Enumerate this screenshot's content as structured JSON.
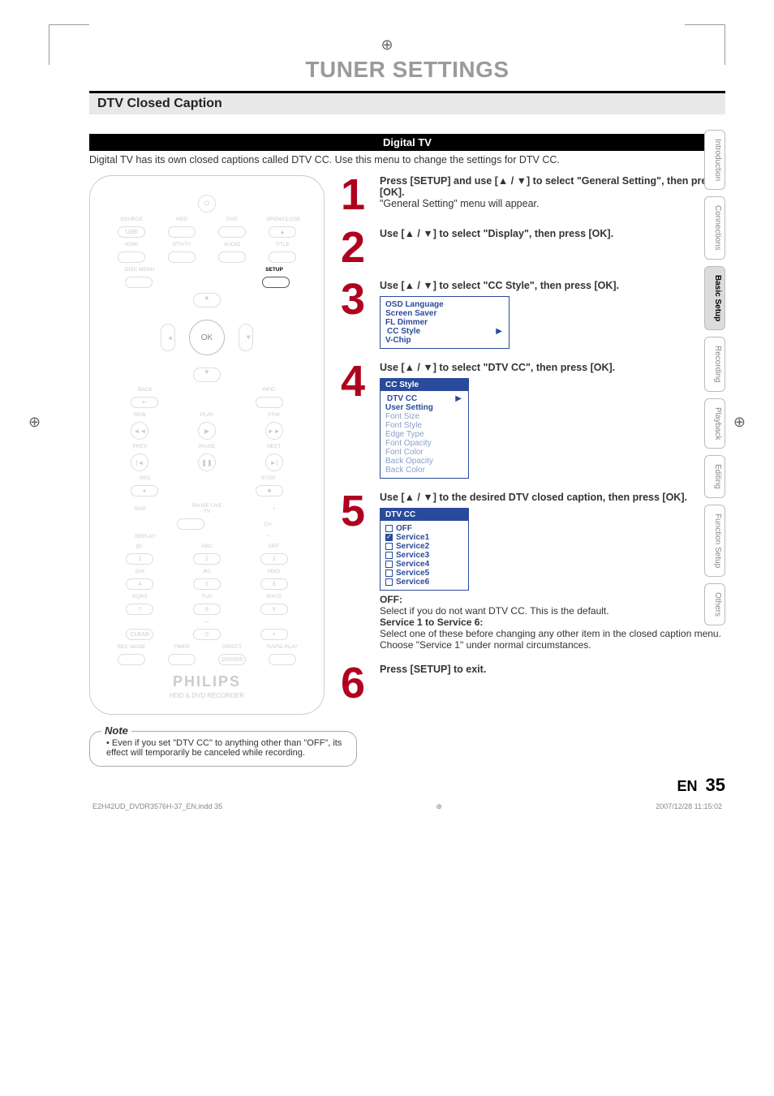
{
  "title": "TUNER SETTINGS",
  "section": "DTV Closed Caption",
  "sub_bar": "Digital TV",
  "intro": "Digital TV has its own closed captions called DTV CC. Use this menu to change the settings for DTV CC.",
  "side_tabs": [
    "Introduction",
    "Connections",
    "Basic Setup",
    "Recording",
    "Playback",
    "Editing",
    "Function Setup",
    "Others"
  ],
  "side_active_index": 2,
  "remote": {
    "brand": "PHILIPS",
    "subtitle": "HDD & DVD RECORDER",
    "setup_label": "SETUP",
    "ok_label": "OK",
    "row1": [
      "SOURCE",
      "HDD",
      "DVD",
      "OPEN/CLOSE"
    ],
    "row1b": [
      "USB",
      "",
      "",
      "▲"
    ],
    "row2": [
      "HDMI",
      "DTV/TV",
      "AUDIO",
      "TITLE"
    ],
    "row3_left": "DISC MENU",
    "row_back": "BACK",
    "row_info": "INFO",
    "rew": "REW",
    "play": "PLAY",
    "ffw": "FFW",
    "prev": "PREV",
    "pause": "PAUSE",
    "next": "NEXT",
    "rec": "REC",
    "stop": "STOP",
    "skip": "SKIP",
    "pauselive": "PAUSE LIVE TV",
    "ch": "CH",
    "replay": "REPLAY",
    "keypad": [
      [
        "@/.",
        "ABC",
        "DEF"
      ],
      [
        "1",
        "2",
        "3"
      ],
      [
        "GHI",
        "JKL",
        "MNO"
      ],
      [
        "4",
        "5",
        "6"
      ],
      [
        "PQRS",
        "TUV",
        "WXYZ"
      ],
      [
        "7",
        "8",
        "9"
      ],
      [
        "",
        "—",
        ""
      ],
      [
        "CLEAR",
        "0",
        "•"
      ],
      [
        "REC MODE",
        "TIMER",
        "DIRECT",
        "RAPID PLAY"
      ]
    ]
  },
  "steps": {
    "s1": {
      "num": "1",
      "bold": "Press [SETUP] and use [▲ / ▼] to select \"General Setting\", then press [OK].",
      "text": "\"General Setting\" menu will appear."
    },
    "s2": {
      "num": "2",
      "bold": "Use [▲ / ▼] to select \"Display\", then press [OK]."
    },
    "s3": {
      "num": "3",
      "bold": "Use [▲ / ▼] to select \"CC Style\", then press [OK].",
      "osd": [
        "OSD Language",
        "Screen Saver",
        "FL Dimmer",
        "CC Style",
        "V-Chip"
      ],
      "osd_selected": "CC Style"
    },
    "s4": {
      "num": "4",
      "bold": "Use [▲ / ▼] to select \"DTV CC\", then press [OK].",
      "osd_header": "CC Style",
      "osd_top": [
        "DTV CC",
        "User Setting"
      ],
      "osd_faded": [
        "Font Size",
        "Font Style",
        "Edge Type",
        "Font Opacity",
        "Font Color",
        "Back Opacity",
        "Back Color"
      ]
    },
    "s5": {
      "num": "5",
      "bold": "Use [▲ / ▼] to the desired DTV closed caption, then press [OK].",
      "osd_header": "DTV CC",
      "options": [
        "OFF",
        "Service1",
        "Service2",
        "Service3",
        "Service4",
        "Service5",
        "Service6"
      ],
      "selected_index": 1,
      "off_label": "OFF:",
      "off_text": "Select if you do not want DTV CC. This is the default.",
      "svc_label": "Service 1 to Service 6:",
      "svc_text": "Select one of these before changing any other item in the closed caption menu. Choose \"Service 1\" under normal circumstances."
    },
    "s6": {
      "num": "6",
      "bold": "Press [SETUP] to exit."
    }
  },
  "note": {
    "title": "Note",
    "item": "Even if you set \"DTV CC\" to anything other than \"OFF\", its effect will temporarily be canceled while recording."
  },
  "footer": {
    "lang": "EN",
    "page": "35",
    "file": "E2H42UD_DVDR3576H-37_EN.indd   35",
    "timestamp": "2007/12/28   11:15:02"
  }
}
